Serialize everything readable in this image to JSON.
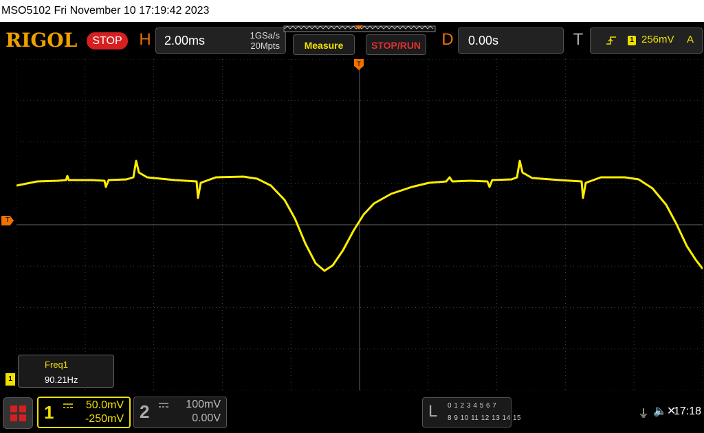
{
  "titlebar": {
    "text": "MSO5102  Fri November 10 17:19:42 2023"
  },
  "brand": {
    "logo": "RIGOL",
    "state": "STOP"
  },
  "horizontal": {
    "key": "H",
    "timebase": "2.00ms",
    "sample_rate": "1GSa/s",
    "memory_depth": "20Mpts"
  },
  "buttons": {
    "measure": "Measure",
    "stop_run": "STOP/RUN"
  },
  "delay": {
    "key": "D",
    "value": "0.00s"
  },
  "trigger": {
    "key": "T",
    "source": "1",
    "level": "256mV",
    "mode": "A"
  },
  "markers": {
    "trigger_level": "T",
    "channel1": "1"
  },
  "measurement": {
    "name": "Freq1",
    "value": "90.21Hz"
  },
  "channels": [
    {
      "number": "1",
      "scale": "50.0mV",
      "offset": "-250mV",
      "color": "#f0e000",
      "active": true
    },
    {
      "number": "2",
      "scale": "100mV",
      "offset": "0.00V",
      "color": "#aaaaaa",
      "active": false
    }
  ],
  "logic": {
    "key": "L",
    "row1": "0 1 2 3  4 5 6 7",
    "row2": "8 9 10 11 12 13 14 15"
  },
  "status": {
    "usb": "⏚",
    "sound": "🔈✕",
    "time": "17:18"
  },
  "colors": {
    "trace": "#ffee00",
    "accent": "#f07000",
    "grid": "#444444",
    "stop": "#d42020"
  }
}
